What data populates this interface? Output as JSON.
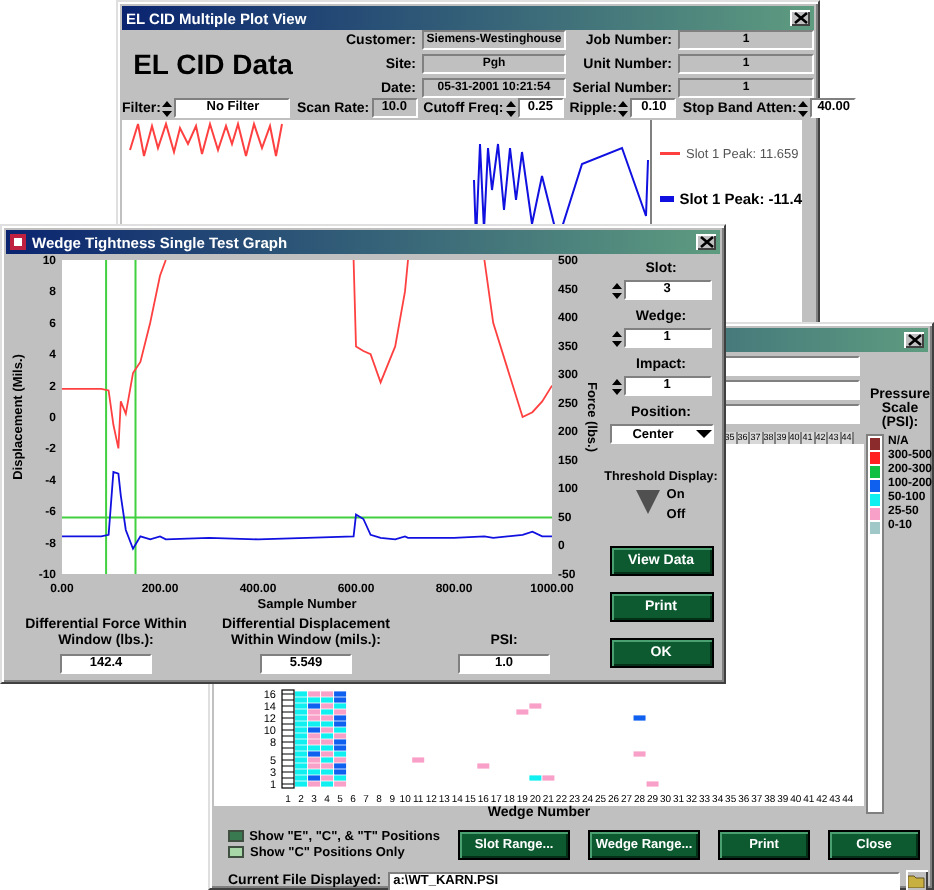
{
  "plot_view": {
    "title": "EL CID Multiple Plot View",
    "heading": "EL CID Data",
    "info": [
      {
        "label": "Customer:",
        "value": "Siemens-Westinghouse"
      },
      {
        "label": "Site:",
        "value": "Pgh"
      },
      {
        "label": "Date:",
        "value": "05-31-2001 10:21:54"
      }
    ],
    "info_right": [
      {
        "label": "Job Number:",
        "value": "1"
      },
      {
        "label": "Unit Number:",
        "value": "1"
      },
      {
        "label": "Serial Number:",
        "value": "1"
      }
    ],
    "filters": [
      {
        "label": "Filter:",
        "value": "No Filter",
        "kind": "spinner"
      },
      {
        "label": "Scan Rate:",
        "value": "10.0",
        "kind": "readout"
      },
      {
        "label": "Cutoff Freq:",
        "value": "0.25",
        "kind": "spinner"
      },
      {
        "label": "Ripple:",
        "value": "0.10",
        "kind": "spinner"
      },
      {
        "label": "Stop Band Atten:",
        "value": "40.00",
        "kind": "spinner"
      }
    ],
    "legend": [
      {
        "text": "Slot 1 Peak: 11.659",
        "color": "#ff4040",
        "bold": false
      },
      {
        "text": "Slot  1  Peak: -11.4",
        "color": "#1010e0",
        "bold": true
      }
    ]
  },
  "graph": {
    "title": "Wedge Tightness Single Test Graph",
    "chart_data": {
      "type": "line",
      "xlabel": "Sample Number",
      "ylabel": "Displacement (Mils.)",
      "x": [
        0,
        80,
        95,
        105,
        115,
        120,
        130,
        145,
        160,
        180,
        200,
        212,
        300,
        400,
        500,
        595,
        600,
        615,
        630,
        650,
        680,
        700,
        706,
        800,
        862,
        880,
        940,
        960,
        980,
        1000
      ],
      "series": [
        {
          "color": "#ff4040",
          "values": [
            1.8,
            1.8,
            1.7,
            -0.5,
            -2,
            1,
            0.2,
            2.8,
            3.5,
            6,
            9,
            10,
            null,
            null,
            null,
            10,
            4.5,
            4.2,
            4,
            2.2,
            4.5,
            8,
            10,
            null,
            10,
            6,
            0,
            0.3,
            1,
            2
          ]
        },
        {
          "color": "#1010e0",
          "values": [
            -7.6,
            -7.6,
            -7.5,
            -3.5,
            -3.6,
            -5,
            -7.2,
            -8.4,
            -7.6,
            -7.8,
            -7.6,
            -7.8,
            -7.7,
            -7.8,
            -7.7,
            -7.6,
            -6.2,
            -6.5,
            -7.5,
            -7.7,
            -7.8,
            -7.6,
            -7.7,
            -7.7,
            -7.6,
            -7.7,
            -7.5,
            -7.3,
            -7.6,
            -7.6
          ]
        }
      ],
      "xlim": [
        0,
        1000
      ],
      "ylim": [
        -10,
        10
      ],
      "xticks": [
        {
          "value": 0,
          "label": "0.00"
        },
        {
          "value": 200,
          "label": "200.00"
        },
        {
          "value": 400,
          "label": "400.00"
        },
        {
          "value": 600,
          "label": "600.00"
        },
        {
          "value": 800,
          "label": "800.00"
        },
        {
          "value": 1000,
          "label": "1000.00"
        }
      ],
      "yticks": [
        -10,
        -8,
        -6,
        -4,
        -2,
        0,
        2,
        4,
        6,
        8,
        10
      ],
      "ref_lines": [
        {
          "axis": "x",
          "value": 90,
          "color": "#40d040"
        },
        {
          "axis": "x",
          "value": 150,
          "color": "#40d040"
        },
        {
          "axis": "y",
          "value": -6.4,
          "color": "#40d040"
        }
      ]
    },
    "force_axis": {
      "label": "Force (lbs.)",
      "ticks": [
        "500",
        "450",
        "400",
        "350",
        "300",
        "250",
        "200",
        "150",
        "100",
        "50",
        "0",
        "-50"
      ]
    },
    "controls": [
      {
        "label": "Slot:",
        "value": "3",
        "kind": "spinner"
      },
      {
        "label": "Wedge:",
        "value": "1",
        "kind": "spinner"
      },
      {
        "label": "Impact:",
        "value": "1",
        "kind": "spinner"
      },
      {
        "label": "Position:",
        "value": "Center",
        "kind": "dropdown"
      }
    ],
    "threshold": {
      "label": "Threshold Display:",
      "on_label": "On",
      "off_label": "Off",
      "on": true
    },
    "buttons": [
      "View Data",
      "Print",
      "OK"
    ],
    "outputs": [
      {
        "label": "Differential Force Within Window (lbs.):",
        "value": "142.4"
      },
      {
        "label": "Differential Displacement Within Window (mils.):",
        "value": "5.549"
      },
      {
        "label": "PSI:",
        "value": "1.0"
      }
    ]
  },
  "map": {
    "column_headers": [
      "35",
      "36",
      "37",
      "38",
      "39",
      "40",
      "41",
      "42",
      "43",
      "44"
    ],
    "pressure_scale": {
      "title": "Pressure Scale (PSI):",
      "items": [
        {
          "label": "N/A",
          "color": "#8b2b2b"
        },
        {
          "label": "300-500",
          "color": "#ff2020"
        },
        {
          "label": "200-300",
          "color": "#10c040"
        },
        {
          "label": "100-200",
          "color": "#1060f0"
        },
        {
          "label": "50-100",
          "color": "#10f0f0"
        },
        {
          "label": "25-50",
          "color": "#f8a0c8"
        },
        {
          "label": "0-10",
          "color": "#a0c8c8"
        }
      ]
    },
    "y_labels": [
      "16",
      "14",
      "12",
      "10",
      "8",
      "5",
      "3",
      "1"
    ],
    "x_labels": [
      "1",
      "2",
      "3",
      "4",
      "5",
      "6",
      "7",
      "8",
      "9",
      "10",
      "11",
      "12",
      "13",
      "14",
      "15",
      "16",
      "17",
      "18",
      "19",
      "20",
      "21",
      "22",
      "23",
      "24",
      "25",
      "26",
      "27",
      "28",
      "29",
      "30",
      "31",
      "32",
      "33",
      "34",
      "35",
      "36",
      "37",
      "38",
      "39",
      "40",
      "41",
      "42",
      "43",
      "44"
    ],
    "xlabel": "Wedge Number",
    "options": [
      {
        "label": "Show \"E\", \"C\", & \"T\" Positions",
        "selected": true
      },
      {
        "label": "Show \"C\" Positions Only",
        "selected": false
      }
    ],
    "buttons": [
      "Slot Range...",
      "Wedge Range...",
      "Print",
      "Close"
    ],
    "file": {
      "label": "Current File Displayed:",
      "value": "a:\\WT_KARN.PSI"
    }
  }
}
